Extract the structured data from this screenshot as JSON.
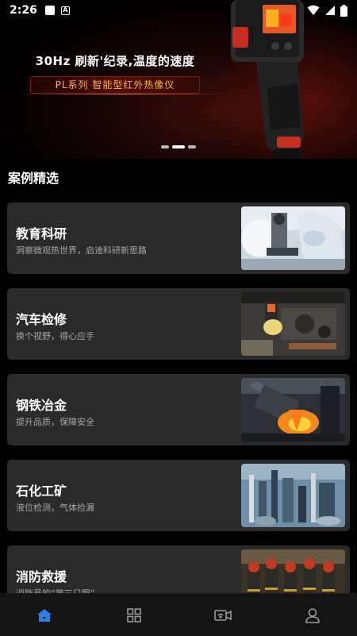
{
  "status_bar": {
    "time": "2:26"
  },
  "banner": {
    "title": "30Hz 刷新'纪录,温度的速度",
    "subtitle": "PL系列 智能型红外热像仪",
    "slide_count": 3,
    "active_slide": 1
  },
  "section": {
    "title": "案例精选"
  },
  "cases": [
    {
      "title": "教育科研",
      "desc": "洞察微观热世界，启迪科研新思路",
      "image": "lab-microscope"
    },
    {
      "title": "汽车检修",
      "desc": "换个视野，得心应手",
      "image": "car-engine-inspection"
    },
    {
      "title": "钢铁冶金",
      "desc": "提升品质，保障安全",
      "image": "steel-furnace"
    },
    {
      "title": "石化工矿",
      "desc": "液位检测，气体捡漏",
      "image": "petrochemical-plant"
    },
    {
      "title": "消防救援",
      "desc": "消防员的“第三只眼”",
      "image": "firefighters"
    }
  ],
  "nav": {
    "items": [
      {
        "icon": "home-icon",
        "active": true
      },
      {
        "icon": "grid-icon",
        "active": false
      },
      {
        "icon": "camera-icon",
        "active": false
      },
      {
        "icon": "user-icon",
        "active": false
      }
    ],
    "active_color": "#2f7fe8",
    "inactive_color": "#9a9a9a"
  }
}
